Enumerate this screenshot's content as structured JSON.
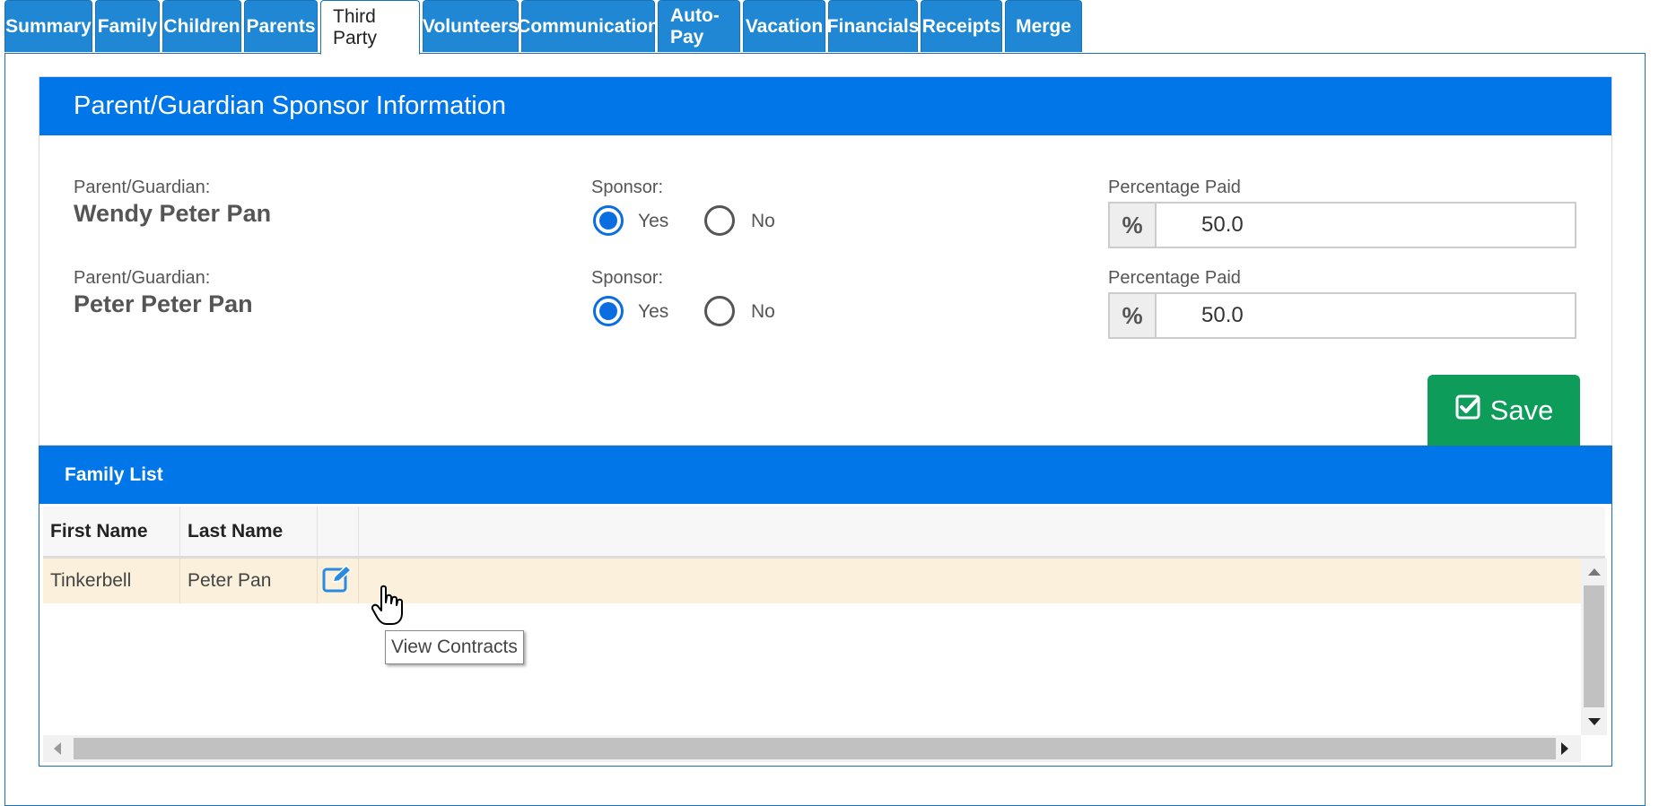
{
  "tabs": [
    {
      "label": "Summary"
    },
    {
      "label": "Family"
    },
    {
      "label": "Children"
    },
    {
      "label": "Parents"
    },
    {
      "label": "Third Party",
      "active": true
    },
    {
      "label": "Volunteers"
    },
    {
      "label": "Communication"
    },
    {
      "label": "Auto-Pay"
    },
    {
      "label": "Vacation"
    },
    {
      "label": "Financials"
    },
    {
      "label": "Receipts"
    },
    {
      "label": "Merge"
    }
  ],
  "sponsor_panel": {
    "title": "Parent/Guardian Sponsor Information",
    "parent_label": "Parent/Guardian:",
    "sponsor_label": "Sponsor:",
    "yes_label": "Yes",
    "no_label": "No",
    "percentage_label": "Percentage Paid",
    "percent_symbol": "%",
    "rows": [
      {
        "name": "Wendy Peter Pan",
        "sponsor": "Yes",
        "percentage": "50.0"
      },
      {
        "name": "Peter Peter Pan",
        "sponsor": "Yes",
        "percentage": "50.0"
      }
    ],
    "save_label": "Save"
  },
  "family_list": {
    "title": "Family List",
    "columns": [
      "First Name",
      "Last Name"
    ],
    "rows": [
      {
        "first_name": "Tinkerbell",
        "last_name": "Peter Pan"
      }
    ],
    "tooltip": "View Contracts"
  },
  "colors": {
    "tab_blue": "#1f87d4",
    "header_blue": "#0076e8",
    "save_green": "#0d9c5a",
    "row_highlight": "#faf0dc",
    "radio_blue": "#0b6ee0"
  }
}
